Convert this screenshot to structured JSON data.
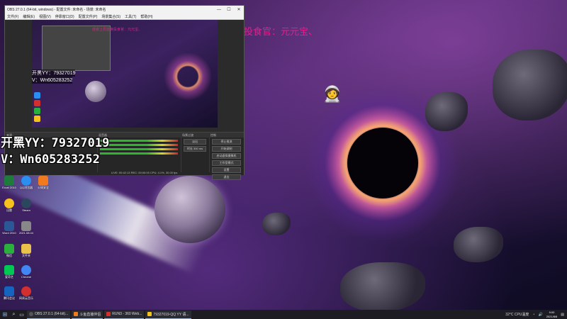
{
  "stream": {
    "thanks_text": "感谢上周首席投食官：元元宝、"
  },
  "overlay": {
    "yy_label": "开黑YY：79327019",
    "wechat_label": "V：Wn605283252"
  },
  "obs": {
    "title": "OBS 27.0.1 (64-bit, windows) - 配置文件: 未命名 - 场景: 未命名",
    "menu": [
      "文件(F)",
      "编辑(E)",
      "视图(V)",
      "停靠窗口(D)",
      "配置文件(P)",
      "场景集合(S)",
      "工具(T)",
      "帮助(H)"
    ],
    "preview_overlay_yy": "开黑YY：79327019",
    "preview_overlay_v": "V：Wn605283252",
    "preview_text": "感谢上周首席投食官：元元宝、",
    "docks": [
      "来源",
      "混音器",
      "场景过渡",
      "控制"
    ],
    "controls": [
      "停止推流",
      "开始录制",
      "启动虚拟摄像机",
      "工作室模式",
      "设置",
      "退出"
    ],
    "transition_label": "淡出",
    "duration_label": "时长 300 ms",
    "status": "LIVE: 00:42:13  REC: 00:00:00  CPU: 4.1%, 30.00 fps"
  },
  "desktop_icons": [
    {
      "label": "Excel 2010",
      "color": "#1e7b3c"
    },
    {
      "label": "QQ浏览器",
      "color": "#2a8ff0"
    },
    {
      "label": "火绒安全",
      "color": "#f07a1e"
    },
    {
      "label": "迅雷",
      "color": "#f6c31e"
    },
    {
      "label": "Steam",
      "color": "#2a475e"
    },
    {
      "label": "Word 2010",
      "color": "#2b5797"
    },
    {
      "label": "2021.08.04",
      "color": "#888888"
    },
    {
      "label": "微信",
      "color": "#2ab03c"
    },
    {
      "label": "文件夹",
      "color": "#e8c24a"
    },
    {
      "label": "爱奇艺",
      "color": "#00c853"
    },
    {
      "label": "Chrome",
      "color": "#4285f4"
    },
    {
      "label": "网易云音乐",
      "color": "#d32f2f"
    },
    {
      "label": "腾讯会议",
      "color": "#1565c0"
    }
  ],
  "taskbar": {
    "apps": [
      {
        "label": "OBS 27.0.1 (64-bit)...",
        "color": "#333333"
      },
      {
        "label": "斗鱼直播伴侣",
        "color": "#f07a1e"
      },
      {
        "label": "RUN3 - 360 Web...",
        "color": "#d32f2f"
      },
      {
        "label": "79327019-QQ YY 语...",
        "color": "#f6c31e"
      }
    ],
    "tray_text": "32°C CPU温度",
    "time": "9:00",
    "date": "2021/8/8"
  }
}
